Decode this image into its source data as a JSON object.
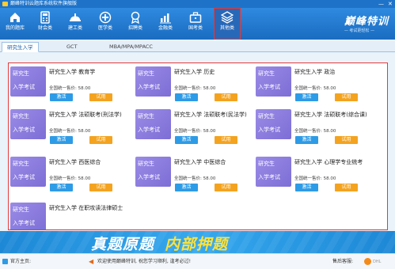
{
  "window": {
    "title": "巅峰特训云题库系统软件旗舰版",
    "minimize": "—",
    "close": "✕"
  },
  "toolbar": {
    "items": [
      {
        "label": "我的题库",
        "icon": "home-icon"
      },
      {
        "label": "财会类",
        "icon": "calculator-icon"
      },
      {
        "label": "建工类",
        "icon": "hard-hat-icon"
      },
      {
        "label": "医学类",
        "icon": "medical-cross-icon"
      },
      {
        "label": "招聘类",
        "icon": "badge-icon"
      },
      {
        "label": "金融类",
        "icon": "bar-chart-icon"
      },
      {
        "label": "国考类",
        "icon": "briefcase-icon"
      },
      {
        "label": "其他类",
        "icon": "layers-icon"
      }
    ],
    "active_index": 7
  },
  "brand": {
    "name": "巅峰特训",
    "slogan": "— 考试更轻松 —"
  },
  "tabs": [
    {
      "label": "研究生入学",
      "active": true
    },
    {
      "label": "GCT",
      "active": false
    },
    {
      "label": "MBA/MPA/MPACC",
      "active": false
    }
  ],
  "cards": [
    {
      "thumb_line1": "研究生",
      "thumb_line2": "入学考试",
      "title": "研究生入学 教育学",
      "price": "全国统一售价: 58.00",
      "activate": "激活",
      "trial": "试用"
    },
    {
      "thumb_line1": "研究生",
      "thumb_line2": "入学考试",
      "title": "研究生入学 历史",
      "price": "全国统一售价: 58.00",
      "activate": "激活",
      "trial": "试用"
    },
    {
      "thumb_line1": "研究生",
      "thumb_line2": "入学考试",
      "title": "研究生入学 政治",
      "price": "全国统一售价: 58.00",
      "activate": "激活",
      "trial": "试用"
    },
    {
      "thumb_line1": "研究生",
      "thumb_line2": "入学考试",
      "title": "研究生入学 法硕联考(刑法学)",
      "price": "全国统一售价: 58.00",
      "activate": "激活",
      "trial": "试用"
    },
    {
      "thumb_line1": "研究生",
      "thumb_line2": "入学考试",
      "title": "研究生入学 法硕联考(民法学)",
      "price": "全国统一售价: 58.00",
      "activate": "激活",
      "trial": "试用"
    },
    {
      "thumb_line1": "研究生",
      "thumb_line2": "入学考试",
      "title": "研究生入学 法硕联考(综合课)",
      "price": "全国统一售价: 58.00",
      "activate": "激活",
      "trial": "试用"
    },
    {
      "thumb_line1": "研究生",
      "thumb_line2": "入学考试",
      "title": "研究生入学 西医综合",
      "price": "全国统一售价: 58.00",
      "activate": "激活",
      "trial": "试用"
    },
    {
      "thumb_line1": "研究生",
      "thumb_line2": "入学考试",
      "title": "研究生入学 中医综合",
      "price": "全国统一售价: 58.00",
      "activate": "激活",
      "trial": "试用"
    },
    {
      "thumb_line1": "研究生",
      "thumb_line2": "入学考试",
      "title": "研究生入学 心理学专业统考",
      "price": "全国统一售价: 58.00",
      "activate": "激活",
      "trial": "试用"
    },
    {
      "thumb_line1": "研究生",
      "thumb_line2": "入学考试",
      "title": "研究生入学 在职攻读法律硕士",
      "price": "",
      "activate": "",
      "trial": ""
    }
  ],
  "banner": {
    "part1": "真题原题",
    "part2": "内部押题"
  },
  "statusbar": {
    "home_label": "官方主页:",
    "notice": "欢迎使用巅峰特训, 祝您学习顺利, 逢考必过!",
    "service_label": "售后客服:",
    "watermark": "DHL"
  },
  "colors": {
    "toolbar": "#1e73c9",
    "highlight_border": "#e43a3a",
    "activate_button": "#2e9be6",
    "trial_button": "#f4a320",
    "thumbnail": "#8a7ce0"
  }
}
